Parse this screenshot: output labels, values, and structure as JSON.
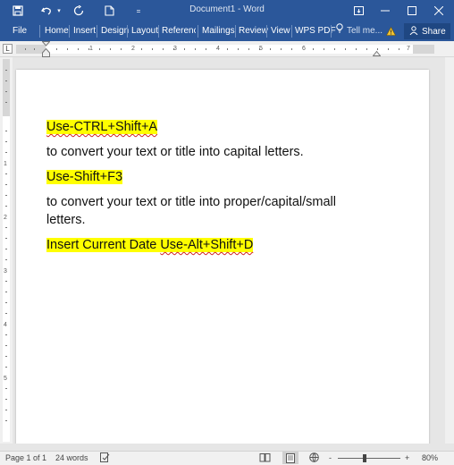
{
  "titlebar": {
    "doc_title": "Document1 - Word",
    "quick_access": [
      "save-icon",
      "undo-icon",
      "redo-icon",
      "new-document-icon",
      "customize-icon"
    ],
    "bg": "#2b579a"
  },
  "ribbon": {
    "tabs": [
      "File",
      "Home",
      "Insert",
      "Design",
      "Layout",
      "References",
      "Mailings",
      "Review",
      "View",
      "WPS PDF"
    ],
    "tell_me": "Tell me...",
    "share": "Share"
  },
  "ruler": {
    "h_numbers": [
      "1",
      "2",
      "3",
      "4",
      "5",
      "6",
      "7"
    ],
    "v_numbers": [
      "1",
      "2",
      "3",
      "4",
      "5"
    ]
  },
  "document": {
    "p1": {
      "before": "Use-CTRL+Shift+A",
      "highlight": "#ffff00"
    },
    "p2": "to convert your text or title into capital letters.",
    "p3": "Use-Shift+F3",
    "p4_line1": "to convert your text or title into proper/capital/small",
    "p4_line2": "letters.",
    "p5_plain": "Insert Current Date ",
    "p5_squig": "Use-Alt+Shift+D"
  },
  "statusbar": {
    "page": "Page 1 of 1",
    "words": "24 words",
    "zoom": "80%",
    "zoom_minus": "-",
    "zoom_plus": "+"
  }
}
